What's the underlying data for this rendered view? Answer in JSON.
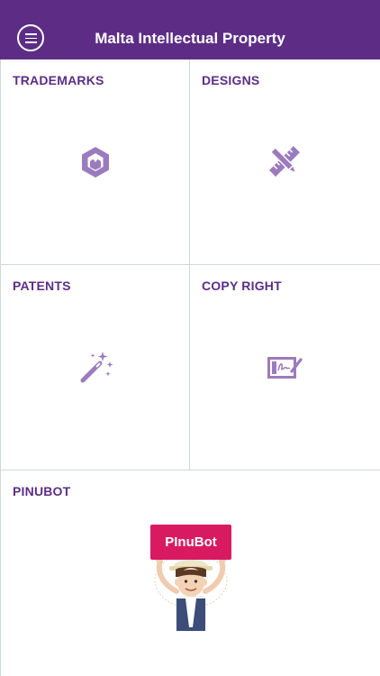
{
  "header": {
    "title": "Malta Intellectual Property",
    "menu_icon": "hamburger-menu-icon"
  },
  "tiles": [
    {
      "label": "TRADEMARKS",
      "icon": "hexagon-badge-icon"
    },
    {
      "label": "DESIGNS",
      "icon": "pencil-ruler-icon"
    },
    {
      "label": "PATENTS",
      "icon": "magic-wand-icon"
    },
    {
      "label": "COPY RIGHT",
      "icon": "signature-pad-icon"
    },
    {
      "label": "PINUBOT",
      "icon": "pinubot-mascot"
    }
  ],
  "pinubot": {
    "sign_text": "PInuBot"
  },
  "colors": {
    "header_bg": "#5d2d86",
    "label": "#5d2d86",
    "icon": "#9b7bbd",
    "sign": "#d81b60",
    "divider": "#cfd8d8"
  }
}
